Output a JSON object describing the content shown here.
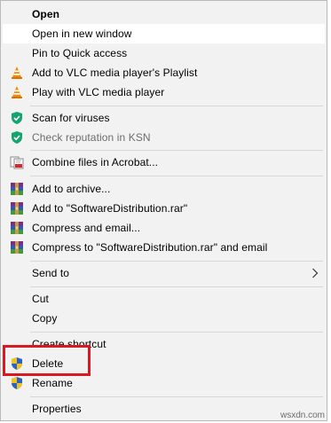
{
  "menu": {
    "items": [
      {
        "label": "Open",
        "icon": "none"
      },
      {
        "label": "Open in new window",
        "icon": "none"
      },
      {
        "label": "Pin to Quick access",
        "icon": "none"
      },
      {
        "label": "Add to VLC media player's Playlist",
        "icon": "vlc-cone-icon"
      },
      {
        "label": "Play with VLC media player",
        "icon": "vlc-cone-icon"
      },
      {
        "label": "Scan for viruses",
        "icon": "kaspersky-shield-icon"
      },
      {
        "label": "Check reputation in KSN",
        "icon": "kaspersky-shield-icon"
      },
      {
        "label": "Combine files in Acrobat...",
        "icon": "acrobat-combine-icon"
      },
      {
        "label": "Add to archive...",
        "icon": "winrar-icon"
      },
      {
        "label": "Add to \"SoftwareDistribution.rar\"",
        "icon": "winrar-icon"
      },
      {
        "label": "Compress and email...",
        "icon": "winrar-icon"
      },
      {
        "label": "Compress to \"SoftwareDistribution.rar\" and email",
        "icon": "winrar-icon"
      },
      {
        "label": "Send to",
        "icon": "none",
        "submenu": true
      },
      {
        "label": "Cut",
        "icon": "none"
      },
      {
        "label": "Copy",
        "icon": "none"
      },
      {
        "label": "Create shortcut",
        "icon": "none"
      },
      {
        "label": "Delete",
        "icon": "uac-shield-icon"
      },
      {
        "label": "Rename",
        "icon": "uac-shield-icon"
      },
      {
        "label": "Properties",
        "icon": "none"
      }
    ]
  },
  "colors": {
    "menu_bg": "#f2f2f2",
    "highlight_bg": "#ffffff",
    "separator": "#d7d7d7",
    "annotation_box": "#d9191f",
    "vlc_orange": "#f08a00",
    "kaspersky_green": "#15a36e",
    "winrar_purple": "#7a2e86"
  },
  "watermark": "wsxdn.com"
}
